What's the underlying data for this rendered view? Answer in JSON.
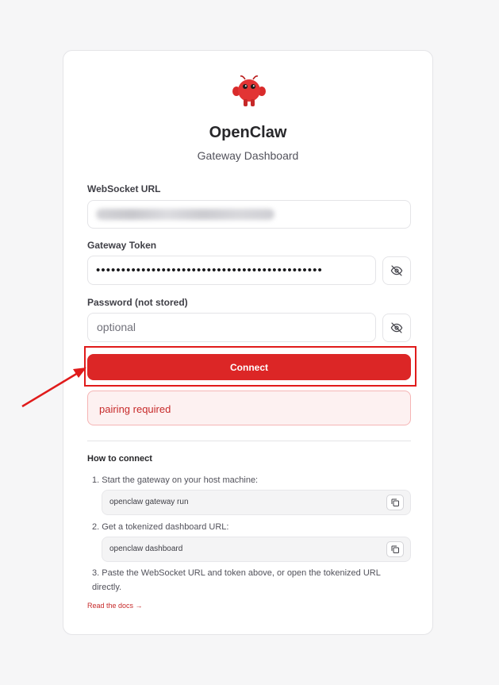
{
  "app": {
    "title": "OpenClaw",
    "subtitle": "Gateway Dashboard",
    "logo": "red-lobster-mascot-icon"
  },
  "form": {
    "websocket_label": "WebSocket URL",
    "websocket_value_state": "blurred",
    "token_label": "Gateway Token",
    "token_masked": "•••••••••••••••••••••••••••••••••••••••••••••",
    "password_label": "Password (not stored)",
    "password_placeholder": "optional",
    "connect_label": "Connect"
  },
  "error": {
    "message": "pairing required"
  },
  "help": {
    "title": "How to connect",
    "step1": "1. Start the gateway on your host machine:",
    "step1_code": "openclaw gateway run",
    "step2": "2. Get a tokenized dashboard URL:",
    "step2_code": "openclaw dashboard",
    "step3": "3. Paste the WebSocket URL and token above, or open the tokenized URL directly.",
    "docs_link": "Read the docs →"
  },
  "colors": {
    "accent": "#dc2626",
    "error_bg": "#fdf1f1",
    "annotation": "#e01b1b"
  }
}
